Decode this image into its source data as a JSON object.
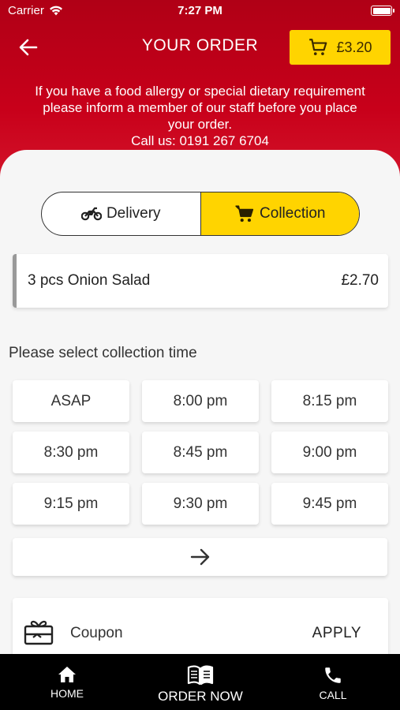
{
  "status_bar": {
    "carrier": "Carrier",
    "time": "7:27 PM"
  },
  "header": {
    "title": "YOUR ORDER",
    "cart_total": "£3.20",
    "allergy_lines": [
      "If you have a food allergy or special dietary requirement",
      "please inform a member of our staff before you place",
      "your order.",
      "Call us: 0191 267 6704"
    ]
  },
  "order_type": {
    "options": [
      {
        "label": "Delivery",
        "icon": "motorbike-icon",
        "selected": false
      },
      {
        "label": "Collection",
        "icon": "cart-icon",
        "selected": true
      }
    ]
  },
  "order_items": [
    {
      "name": "3 pcs Onion Salad",
      "price": "£2.70"
    }
  ],
  "collection": {
    "prompt": "Please select collection time",
    "slots": [
      "ASAP",
      "8:00 pm",
      "8:15 pm",
      "8:30 pm",
      "8:45 pm",
      "9:00 pm",
      "9:15 pm",
      "9:30 pm",
      "9:45 pm"
    ],
    "more_icon": "arrow-right-icon"
  },
  "coupon": {
    "label": "Coupon",
    "action": "APPLY",
    "icon": "gift-card-icon"
  },
  "tabbar": {
    "items": [
      {
        "label": "HOME",
        "icon": "home-icon"
      },
      {
        "label": "ORDER NOW",
        "icon": "menu-book-icon"
      },
      {
        "label": "CALL",
        "icon": "phone-icon"
      }
    ]
  },
  "colors": {
    "brand_red": "#c8001a",
    "accent_yellow": "#ffd400",
    "tabbar": "#000000"
  }
}
